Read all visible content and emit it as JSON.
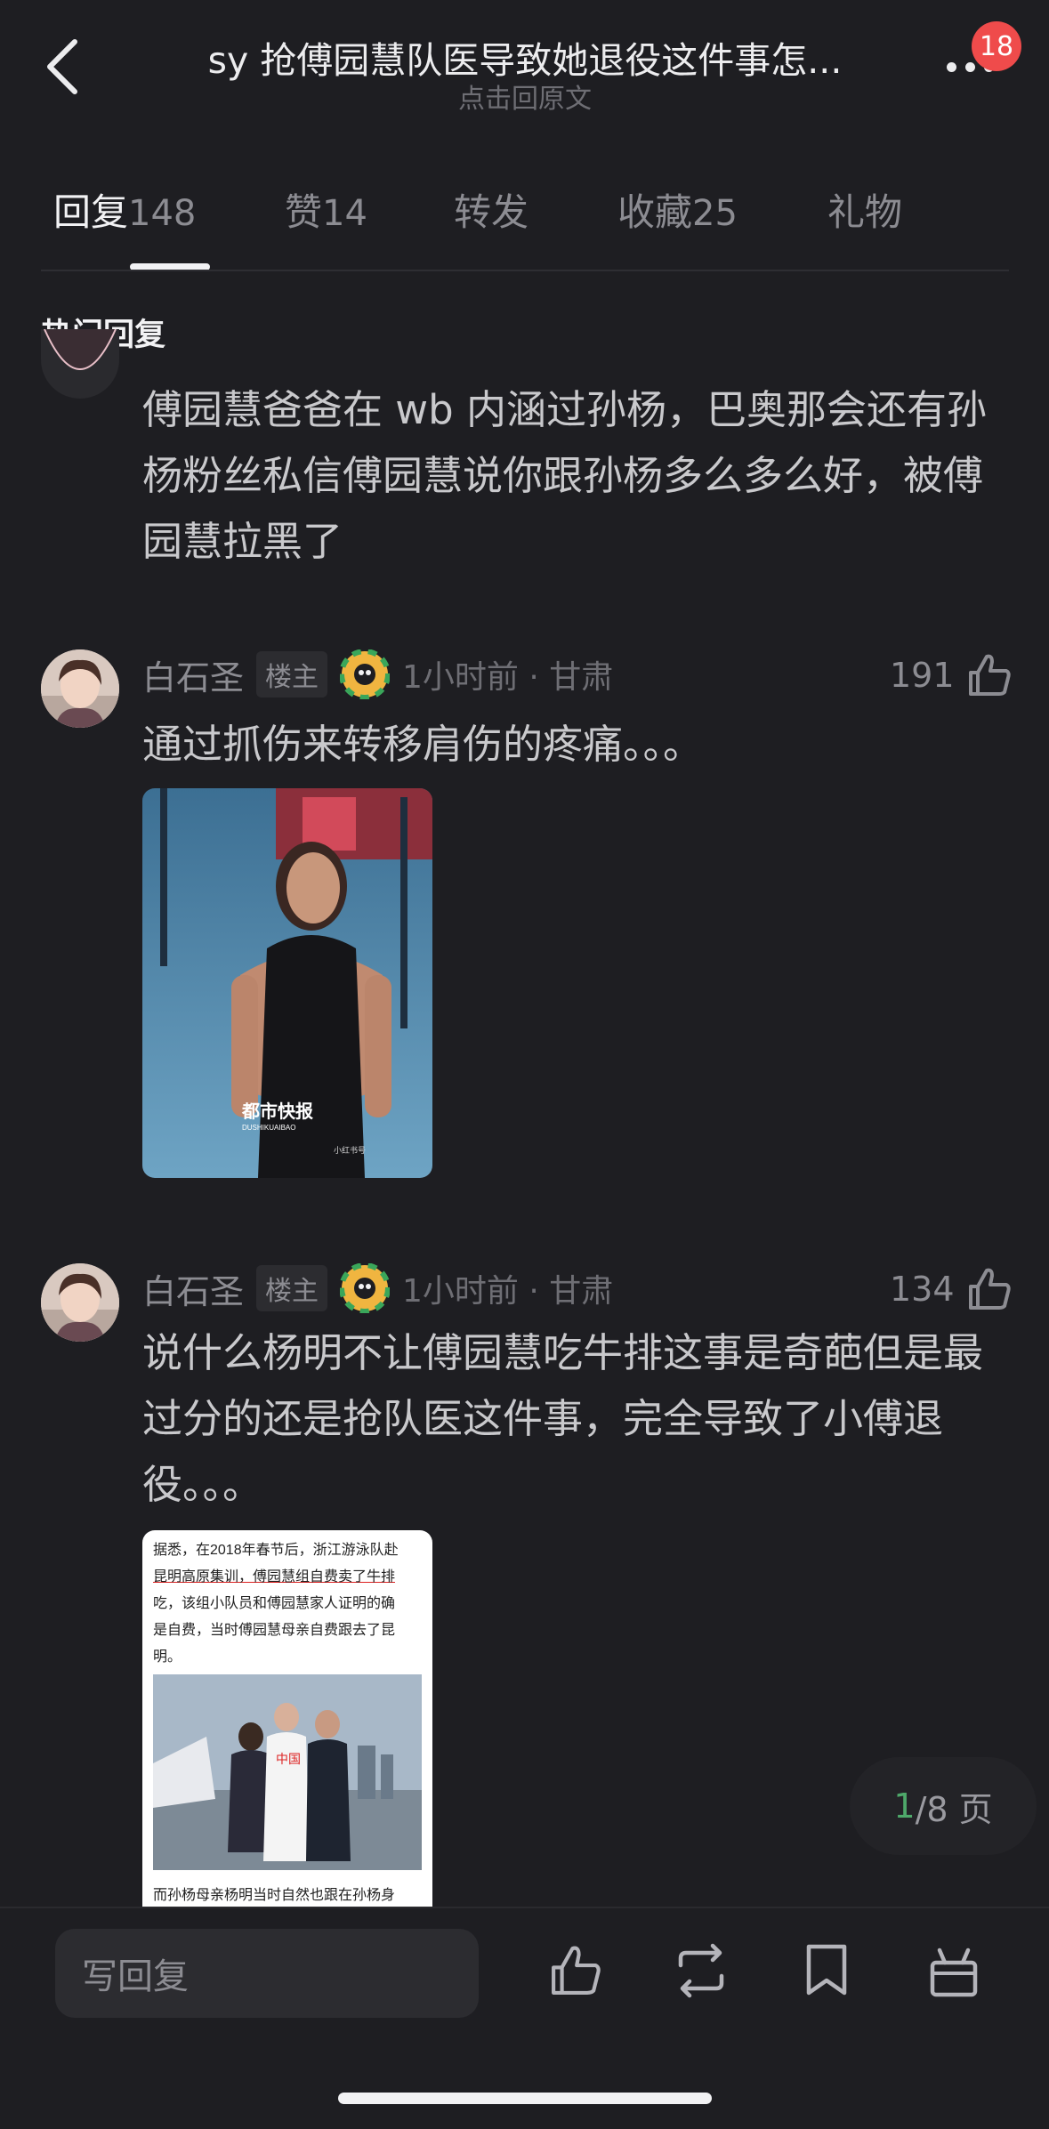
{
  "header": {
    "title": "sy 抢傅园慧队医导致她退役这件事怎...",
    "subtitle": "点击回原文",
    "notification_count": "18"
  },
  "tabs": [
    {
      "label": "回复",
      "count": "148"
    },
    {
      "label": "赞",
      "count": "14"
    },
    {
      "label": "转发",
      "count": ""
    },
    {
      "label": "收藏",
      "count": "25"
    },
    {
      "label": "礼物",
      "count": ""
    }
  ],
  "section_title": "热门回复",
  "comments": [
    {
      "text": "傅园慧爸爸在 wb 内涵过孙杨，巴奥那会还有孙杨粉丝私信傅园慧说你跟孙杨多么多么好，被傅园慧拉黑了"
    },
    {
      "author": "白石圣",
      "badge": "楼主",
      "time": "1小时前 · 甘肃",
      "likes": "191",
      "text": "通过抓伤来转移肩伤的疼痛。。。",
      "image_text": {
        "logo": "都市快报",
        "logo_sub": "DUSHIKUAIBAO",
        "watermark": "小红书号"
      }
    },
    {
      "author": "白石圣",
      "badge": "楼主",
      "time": "1小时前 · 甘肃",
      "likes": "134",
      "text": "说什么杨明不让傅园慧吃牛排这事是奇葩但是最过分的还是抢队医这件事，完全导致了小傅退役。。。",
      "image_text": {
        "lines": [
          "据悉，在2018年春节后，浙江游泳队赴",
          "昆明高原集训，傅园慧组自费卖了牛排",
          "吃，该组小队员和傅园慧家人证明的确",
          "是自费，当时傅园慧母亲自费跟去了昆",
          "明。"
        ],
        "jersey": "中国",
        "bottom_line": "而孙杨母亲杨明当时自然也跟在孙杨身"
      }
    }
  ],
  "pagination": {
    "current": "1",
    "rest": "/8 页"
  },
  "bottom_bar": {
    "reply_placeholder": "写回复"
  }
}
